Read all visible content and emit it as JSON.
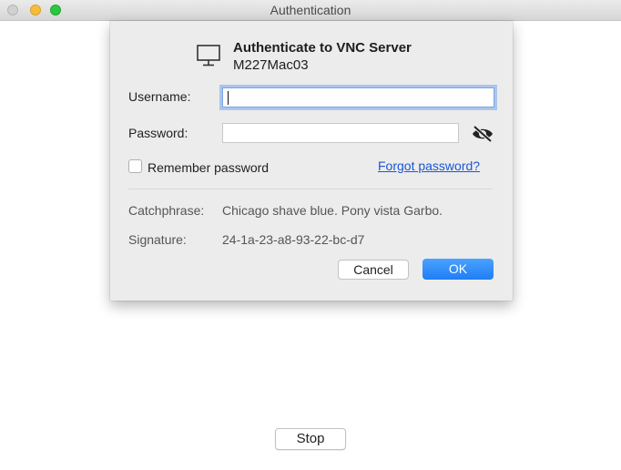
{
  "window": {
    "title": "Authentication"
  },
  "dialog": {
    "title": "Authenticate to VNC Server",
    "host": "M227Mac03",
    "username_label": "Username:",
    "username_value": "",
    "password_label": "Password:",
    "password_value": "",
    "remember_label": "Remember password",
    "remember_checked": false,
    "forgot_link": "Forgot password?",
    "catchphrase_label": "Catchphrase:",
    "catchphrase_value": "Chicago shave blue. Pony vista Garbo.",
    "signature_label": "Signature:",
    "signature_value": "24-1a-23-a8-93-22-bc-d7",
    "cancel_label": "Cancel",
    "ok_label": "OK"
  },
  "footer": {
    "stop_label": "Stop"
  },
  "icons": {
    "monitor": "monitor-icon",
    "password_visibility": "eye-slash-icon"
  },
  "colors": {
    "accent": "#1f7ef5",
    "link": "#1a56d6",
    "focus_ring": "#5f96eb",
    "close": "#d0d0d0",
    "minimize": "#f6bd3b",
    "maximize": "#2ac840"
  }
}
